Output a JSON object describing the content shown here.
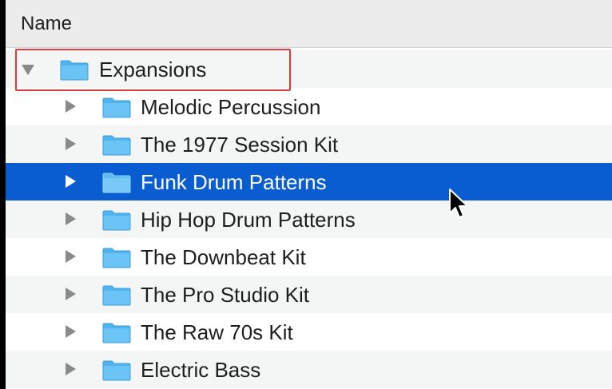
{
  "header": {
    "name_column": "Name"
  },
  "tree": {
    "root": {
      "label": "Expansions",
      "expanded": true
    },
    "children": [
      {
        "label": "Melodic Percussion",
        "selected": false
      },
      {
        "label": "The 1977 Session Kit",
        "selected": false
      },
      {
        "label": "Funk Drum Patterns",
        "selected": true
      },
      {
        "label": "Hip Hop Drum Patterns",
        "selected": false
      },
      {
        "label": "The Downbeat Kit",
        "selected": false
      },
      {
        "label": "The Pro Studio Kit",
        "selected": false
      },
      {
        "label": "The Raw 70s Kit",
        "selected": false
      },
      {
        "label": "Electric Bass",
        "selected": false
      }
    ]
  },
  "icons": {
    "root_toggle": "disclosure-triangle-expanded-icon",
    "child_toggle": "disclosure-triangle-collapsed-icon",
    "folder": "folder-icon",
    "cursor": "mouse-pointer-icon"
  },
  "colors": {
    "selection": "#0a5dd0",
    "folder": "#4fb3ee",
    "annotation_box": "#e23a3a",
    "alt_row": "#f4f5f5"
  }
}
